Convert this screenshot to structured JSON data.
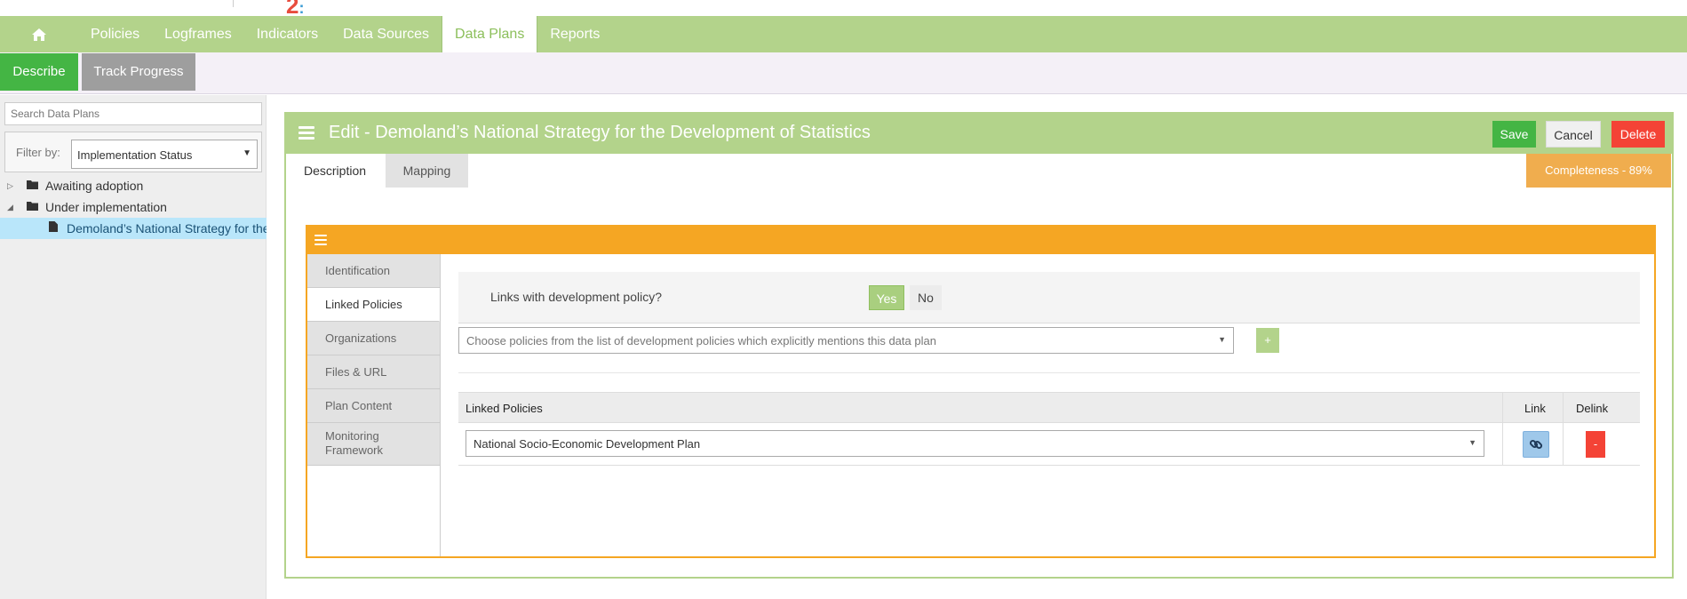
{
  "top": {
    "logo_text": "2",
    "logo_suffix": ":",
    "toplink_fragment": ""
  },
  "nav": {
    "items": [
      {
        "label": "Policies"
      },
      {
        "label": "Logframes"
      },
      {
        "label": "Indicators"
      },
      {
        "label": "Data Sources"
      },
      {
        "label": "Data Plans"
      },
      {
        "label": "Reports"
      }
    ]
  },
  "subnav": {
    "describe": "Describe",
    "track": "Track Progress"
  },
  "sidebar": {
    "search_placeholder": "Search Data Plans",
    "filter_label": "Filter by:",
    "filter_value": "Implementation Status",
    "tree": [
      {
        "label": "Awaiting adoption"
      },
      {
        "label": "Under implementation"
      },
      {
        "label": "Demoland’s National Strategy for the Development of Statistics"
      }
    ]
  },
  "panel": {
    "title": "Edit - Demoland’s National Strategy for the Development of Statistics",
    "save": "Save",
    "cancel": "Cancel",
    "delete": "Delete",
    "tabs": [
      {
        "label": "Description"
      },
      {
        "label": "Mapping"
      }
    ],
    "completeness": "Completeness - 89%"
  },
  "form": {
    "vtabs": [
      {
        "label": "Identification"
      },
      {
        "label": "Linked Policies"
      },
      {
        "label": "Organizations"
      },
      {
        "label": "Files & URL"
      },
      {
        "label": "Plan Content"
      },
      {
        "label": "Monitoring Framework"
      }
    ],
    "question": "Links with development policy?",
    "yes": "Yes",
    "no": "No",
    "choose_placeholder": "Choose policies from the list of development policies which explicitly mentions this data plan",
    "add_symbol": "+",
    "table": {
      "headers": [
        "Linked Policies",
        "Link",
        "Delink"
      ],
      "rows": [
        {
          "policy": "National Socio-Economic Development Plan",
          "delink_symbol": "-"
        }
      ]
    }
  },
  "colors": {
    "nav_green": "#b3d38b",
    "button_green": "#44b544",
    "orange": "#f5a623",
    "delete_red": "#f44336",
    "completeness_orange": "#f0ad4e"
  }
}
